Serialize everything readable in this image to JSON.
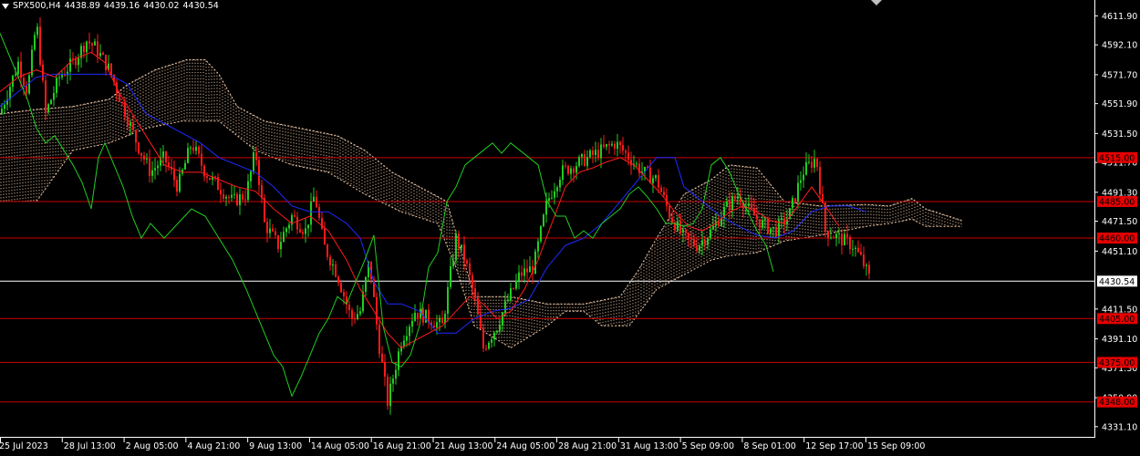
{
  "header": {
    "symbol": "SPX500,H4",
    "open": "4438.89",
    "high": "4439.16",
    "low": "4430.02",
    "close": "4430.54"
  },
  "colors": {
    "background": "#000000",
    "bull": "#22cc22",
    "bear": "#ff1a1a",
    "tenkan": "#ff1a1a",
    "kijun": "#1f2bff",
    "chikou": "#22cc22",
    "cloud": "#f2c9a8",
    "level": "#cc0000",
    "current": "#ffffff",
    "axis": "#ffffff"
  },
  "price_axis": {
    "labels": [
      "4611.90",
      "4592.10",
      "4571.70",
      "4551.90",
      "4531.50",
      "4511.70",
      "4491.30",
      "4471.50",
      "4451.10",
      "4411.50",
      "4391.10",
      "4371.30",
      "4350.90",
      "4331.10"
    ]
  },
  "time_axis": {
    "labels": [
      "25 Jul 2023",
      "28 Jul 13:00",
      "2 Aug 05:00",
      "4 Aug 21:00",
      "9 Aug 13:00",
      "14 Aug 05:00",
      "16 Aug 21:00",
      "21 Aug 13:00",
      "24 Aug 05:00",
      "28 Aug 21:00",
      "31 Aug 13:00",
      "5 Sep 09:00",
      "8 Sep 01:00",
      "12 Sep 17:00",
      "15 Sep 09:00"
    ]
  },
  "levels": [
    {
      "label": "4515.00",
      "price": 4515.0
    },
    {
      "label": "4485.00",
      "price": 4485.0
    },
    {
      "label": "4460.00",
      "price": 4460.0
    },
    {
      "label": "4405.00",
      "price": 4405.0
    },
    {
      "label": "4375.00",
      "price": 4375.0
    },
    {
      "label": "4348.00",
      "price": 4348.0
    }
  ],
  "current_price": {
    "label": "4430.54",
    "price": 4430.54
  },
  "price_range": {
    "min": 4326.0,
    "max": 4619.0
  },
  "candles": {
    "waypoints": [
      [
        0,
        4545
      ],
      [
        20,
        4580
      ],
      [
        30,
        4560
      ],
      [
        40,
        4608
      ],
      [
        50,
        4545
      ],
      [
        65,
        4570
      ],
      [
        80,
        4580
      ],
      [
        95,
        4595
      ],
      [
        105,
        4590
      ],
      [
        120,
        4575
      ],
      [
        135,
        4550
      ],
      [
        150,
        4525
      ],
      [
        165,
        4505
      ],
      [
        180,
        4515
      ],
      [
        195,
        4495
      ],
      [
        210,
        4525
      ],
      [
        225,
        4505
      ],
      [
        240,
        4495
      ],
      [
        255,
        4485
      ],
      [
        270,
        4490
      ],
      [
        280,
        4520
      ],
      [
        290,
        4470
      ],
      [
        305,
        4455
      ],
      [
        320,
        4475
      ],
      [
        335,
        4465
      ],
      [
        345,
        4490
      ],
      [
        355,
        4455
      ],
      [
        370,
        4435
      ],
      [
        385,
        4405
      ],
      [
        395,
        4410
      ],
      [
        405,
        4445
      ],
      [
        415,
        4390
      ],
      [
        425,
        4348
      ],
      [
        440,
        4390
      ],
      [
        455,
        4410
      ],
      [
        470,
        4405
      ],
      [
        485,
        4400
      ],
      [
        500,
        4460
      ],
      [
        510,
        4445
      ],
      [
        520,
        4420
      ],
      [
        530,
        4385
      ],
      [
        545,
        4400
      ],
      [
        555,
        4415
      ],
      [
        570,
        4435
      ],
      [
        585,
        4440
      ],
      [
        600,
        4485
      ],
      [
        615,
        4505
      ],
      [
        630,
        4510
      ],
      [
        645,
        4515
      ],
      [
        660,
        4520
      ],
      [
        675,
        4525
      ],
      [
        690,
        4515
      ],
      [
        705,
        4505
      ],
      [
        720,
        4500
      ],
      [
        735,
        4475
      ],
      [
        750,
        4460
      ],
      [
        765,
        4455
      ],
      [
        780,
        4465
      ],
      [
        795,
        4480
      ],
      [
        810,
        4490
      ],
      [
        820,
        4480
      ],
      [
        835,
        4470
      ],
      [
        850,
        4465
      ],
      [
        865,
        4475
      ],
      [
        880,
        4505
      ],
      [
        895,
        4515
      ],
      [
        905,
        4465
      ],
      [
        920,
        4460
      ],
      [
        935,
        4455
      ],
      [
        945,
        4445
      ],
      [
        955,
        4430
      ]
    ]
  },
  "indicators": {
    "tenkan": [
      [
        0,
        4560
      ],
      [
        20,
        4570
      ],
      [
        40,
        4575
      ],
      [
        60,
        4570
      ],
      [
        80,
        4582
      ],
      [
        100,
        4587
      ],
      [
        115,
        4580
      ],
      [
        130,
        4560
      ],
      [
        145,
        4545
      ],
      [
        160,
        4530
      ],
      [
        180,
        4510
      ],
      [
        200,
        4505
      ],
      [
        220,
        4505
      ],
      [
        240,
        4500
      ],
      [
        260,
        4495
      ],
      [
        280,
        4492
      ],
      [
        300,
        4480
      ],
      [
        320,
        4470
      ],
      [
        340,
        4475
      ],
      [
        360,
        4465
      ],
      [
        380,
        4445
      ],
      [
        395,
        4425
      ],
      [
        405,
        4415
      ],
      [
        415,
        4405
      ],
      [
        425,
        4395
      ],
      [
        440,
        4385
      ],
      [
        455,
        4390
      ],
      [
        470,
        4395
      ],
      [
        485,
        4400
      ],
      [
        500,
        4410
      ],
      [
        515,
        4420
      ],
      [
        530,
        4415
      ],
      [
        545,
        4405
      ],
      [
        560,
        4410
      ],
      [
        575,
        4425
      ],
      [
        590,
        4445
      ],
      [
        605,
        4470
      ],
      [
        620,
        4495
      ],
      [
        635,
        4505
      ],
      [
        650,
        4508
      ],
      [
        665,
        4512
      ],
      [
        680,
        4515
      ],
      [
        695,
        4510
      ],
      [
        710,
        4500
      ],
      [
        725,
        4490
      ],
      [
        740,
        4478
      ],
      [
        755,
        4468
      ],
      [
        770,
        4465
      ],
      [
        785,
        4470
      ],
      [
        800,
        4478
      ],
      [
        815,
        4482
      ],
      [
        830,
        4478
      ],
      [
        845,
        4472
      ],
      [
        860,
        4470
      ],
      [
        875,
        4482
      ],
      [
        890,
        4495
      ],
      [
        905,
        4482
      ],
      [
        920,
        4468
      ]
    ],
    "kijun": [
      [
        0,
        4550
      ],
      [
        20,
        4560
      ],
      [
        40,
        4570
      ],
      [
        60,
        4572
      ],
      [
        90,
        4572
      ],
      [
        120,
        4572
      ],
      [
        140,
        4565
      ],
      [
        160,
        4545
      ],
      [
        190,
        4535
      ],
      [
        220,
        4525
      ],
      [
        240,
        4515
      ],
      [
        260,
        4510
      ],
      [
        280,
        4505
      ],
      [
        300,
        4495
      ],
      [
        320,
        4482
      ],
      [
        340,
        4478
      ],
      [
        360,
        4478
      ],
      [
        380,
        4470
      ],
      [
        395,
        4460
      ],
      [
        410,
        4430
      ],
      [
        425,
        4415
      ],
      [
        440,
        4415
      ],
      [
        460,
        4410
      ],
      [
        480,
        4395
      ],
      [
        500,
        4395
      ],
      [
        520,
        4405
      ],
      [
        540,
        4410
      ],
      [
        560,
        4412
      ],
      [
        580,
        4418
      ],
      [
        600,
        4440
      ],
      [
        620,
        4455
      ],
      [
        640,
        4460
      ],
      [
        660,
        4470
      ],
      [
        680,
        4485
      ],
      [
        700,
        4500
      ],
      [
        720,
        4515
      ],
      [
        740,
        4515
      ],
      [
        750,
        4495
      ],
      [
        770,
        4485
      ],
      [
        790,
        4475
      ],
      [
        810,
        4468
      ],
      [
        830,
        4462
      ],
      [
        850,
        4460
      ],
      [
        870,
        4465
      ],
      [
        890,
        4478
      ],
      [
        910,
        4482
      ],
      [
        930,
        4482
      ],
      [
        950,
        4478
      ]
    ],
    "chikou": [
      [
        0,
        4600
      ],
      [
        10,
        4585
      ],
      [
        20,
        4570
      ],
      [
        30,
        4555
      ],
      [
        40,
        4535
      ],
      [
        50,
        4525
      ],
      [
        60,
        4530
      ],
      [
        70,
        4520
      ],
      [
        80,
        4510
      ],
      [
        90,
        4498
      ],
      [
        100,
        4480
      ],
      [
        108,
        4515
      ],
      [
        115,
        4525
      ],
      [
        125,
        4510
      ],
      [
        135,
        4495
      ],
      [
        145,
        4475
      ],
      [
        155,
        4460
      ],
      [
        165,
        4470
      ],
      [
        180,
        4460
      ],
      [
        195,
        4470
      ],
      [
        210,
        4480
      ],
      [
        225,
        4475
      ],
      [
        240,
        4460
      ],
      [
        255,
        4445
      ],
      [
        270,
        4425
      ],
      [
        280,
        4410
      ],
      [
        290,
        4395
      ],
      [
        300,
        4380
      ],
      [
        310,
        4372
      ],
      [
        320,
        4352
      ],
      [
        330,
        4365
      ],
      [
        340,
        4380
      ],
      [
        350,
        4395
      ],
      [
        360,
        4405
      ],
      [
        370,
        4420
      ],
      [
        380,
        4415
      ],
      [
        390,
        4430
      ],
      [
        400,
        4445
      ],
      [
        410,
        4462
      ],
      [
        420,
        4400
      ],
      [
        430,
        4375
      ],
      [
        440,
        4372
      ],
      [
        450,
        4380
      ],
      [
        460,
        4400
      ],
      [
        470,
        4440
      ],
      [
        480,
        4450
      ],
      [
        490,
        4485
      ],
      [
        500,
        4495
      ],
      [
        510,
        4510
      ],
      [
        520,
        4515
      ],
      [
        530,
        4520
      ],
      [
        540,
        4525
      ],
      [
        550,
        4518
      ],
      [
        560,
        4525
      ],
      [
        570,
        4520
      ],
      [
        580,
        4515
      ],
      [
        590,
        4510
      ],
      [
        600,
        4485
      ],
      [
        610,
        4475
      ],
      [
        620,
        4475
      ],
      [
        630,
        4460
      ],
      [
        640,
        4465
      ],
      [
        650,
        4460
      ],
      [
        660,
        4470
      ],
      [
        670,
        4475
      ],
      [
        680,
        4480
      ],
      [
        690,
        4490
      ],
      [
        700,
        4495
      ],
      [
        710,
        4488
      ],
      [
        720,
        4480
      ],
      [
        730,
        4470
      ],
      [
        740,
        4470
      ],
      [
        750,
        4468
      ],
      [
        760,
        4470
      ],
      [
        770,
        4480
      ],
      [
        780,
        4510
      ],
      [
        790,
        4515
      ],
      [
        800,
        4505
      ],
      [
        810,
        4490
      ],
      [
        820,
        4478
      ],
      [
        830,
        4465
      ],
      [
        840,
        4455
      ],
      [
        848,
        4437
      ]
    ],
    "cloud": {
      "upper": [
        [
          0,
          4545
        ],
        [
          40,
          4548
        ],
        [
          80,
          4550
        ],
        [
          120,
          4555
        ],
        [
          140,
          4565
        ],
        [
          170,
          4575
        ],
        [
          205,
          4582
        ],
        [
          225,
          4582
        ],
        [
          240,
          4572
        ],
        [
          260,
          4550
        ],
        [
          290,
          4540
        ],
        [
          330,
          4535
        ],
        [
          370,
          4530
        ],
        [
          400,
          4520
        ],
        [
          430,
          4505
        ],
        [
          460,
          4495
        ],
        [
          490,
          4485
        ],
        [
          520,
          4420
        ],
        [
          560,
          4420
        ],
        [
          600,
          4415
        ],
        [
          640,
          4415
        ],
        [
          680,
          4420
        ],
        [
          700,
          4438
        ],
        [
          720,
          4460
        ],
        [
          750,
          4490
        ],
        [
          780,
          4500
        ],
        [
          800,
          4510
        ],
        [
          830,
          4508
        ],
        [
          860,
          4485
        ],
        [
          900,
          4482
        ],
        [
          950,
          4483
        ],
        [
          975,
          4482
        ],
        [
          1000,
          4487
        ],
        [
          1015,
          4480
        ],
        [
          1040,
          4475
        ],
        [
          1055,
          4472
        ]
      ],
      "lower": [
        [
          0,
          4485
        ],
        [
          40,
          4485
        ],
        [
          80,
          4520
        ],
        [
          120,
          4525
        ],
        [
          160,
          4535
        ],
        [
          200,
          4540
        ],
        [
          240,
          4540
        ],
        [
          280,
          4520
        ],
        [
          320,
          4510
        ],
        [
          360,
          4505
        ],
        [
          400,
          4490
        ],
        [
          440,
          4478
        ],
        [
          480,
          4470
        ],
        [
          500,
          4440
        ],
        [
          520,
          4400
        ],
        [
          560,
          4385
        ],
        [
          600,
          4400
        ],
        [
          620,
          4410
        ],
        [
          640,
          4410
        ],
        [
          660,
          4400
        ],
        [
          690,
          4400
        ],
        [
          720,
          4425
        ],
        [
          750,
          4435
        ],
        [
          780,
          4445
        ],
        [
          800,
          4448
        ],
        [
          830,
          4450
        ],
        [
          860,
          4458
        ],
        [
          900,
          4462
        ],
        [
          950,
          4468
        ],
        [
          975,
          4470
        ],
        [
          1000,
          4473
        ],
        [
          1015,
          4468
        ],
        [
          1040,
          4468
        ],
        [
          1055,
          4468
        ]
      ]
    }
  }
}
